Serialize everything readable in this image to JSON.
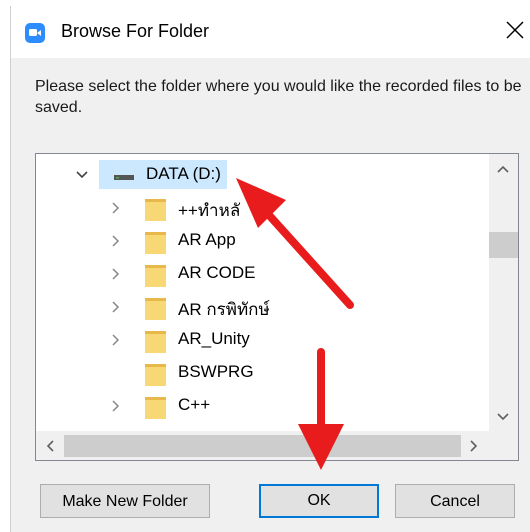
{
  "window": {
    "title": "Browse For Folder",
    "accent": "#2d8cff"
  },
  "instructions": "Please select the folder where you would like the recorded files to be saved.",
  "tree": {
    "drive": {
      "label": "DATA (D:)",
      "expanded": true,
      "selected": true
    },
    "folders": [
      {
        "label": "++ทำหลั",
        "has_children": true
      },
      {
        "label": "AR App",
        "has_children": true
      },
      {
        "label": "AR CODE",
        "has_children": true
      },
      {
        "label": "AR กรพิทักษ์",
        "has_children": true
      },
      {
        "label": "AR_Unity",
        "has_children": true
      },
      {
        "label": "BSWPRG",
        "has_children": false
      },
      {
        "label": "C++",
        "has_children": true
      }
    ]
  },
  "buttons": {
    "make_new_folder": "Make New Folder",
    "ok": "OK",
    "cancel": "Cancel"
  },
  "annotation_color": "#e81c1c"
}
